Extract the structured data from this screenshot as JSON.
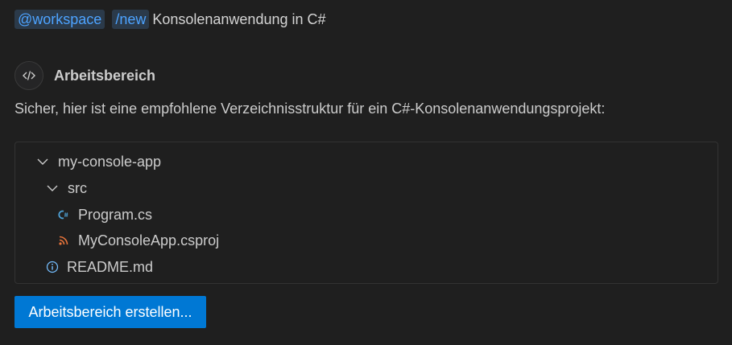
{
  "prompt": {
    "agent_chip": "@workspace",
    "command_chip": "/new",
    "text": "Konsolenanwendung in C#"
  },
  "response": {
    "responder_name": "Arbeitsbereich",
    "responder_icon": "code-icon",
    "description": "Sicher, hier ist eine empfohlene Verzeichnisstruktur für ein C#-Konsolenanwendungsprojekt:"
  },
  "file_tree": {
    "items": [
      {
        "label": "my-console-app",
        "icon": "chevron-down-icon",
        "depth": 0
      },
      {
        "label": "src",
        "icon": "chevron-down-icon",
        "depth": 1
      },
      {
        "label": "Program.cs",
        "icon": "csharp-file-icon",
        "depth": 2
      },
      {
        "label": "MyConsoleApp.csproj",
        "icon": "rss-file-icon",
        "depth": 2
      },
      {
        "label": "README.md",
        "icon": "info-icon",
        "depth": 1
      }
    ]
  },
  "actions": {
    "create_label": "Arbeitsbereich erstellen..."
  },
  "colors": {
    "background": "#1f1f1f",
    "chip_text": "#4da3ff",
    "chip_bg": "#2b3a4a",
    "button_bg": "#0078d4",
    "csharp_icon": "#4fa3d8",
    "rss_icon": "#e8743b",
    "info_icon": "#75beff"
  }
}
